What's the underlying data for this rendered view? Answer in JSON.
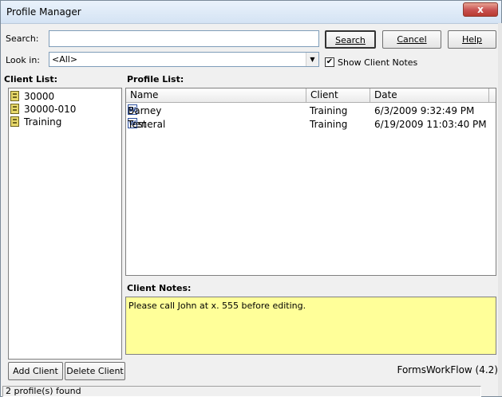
{
  "window": {
    "title": "Profile Manager",
    "close_label": "x"
  },
  "search": {
    "label": "Search:",
    "value": ""
  },
  "look_in": {
    "label": "Look in:",
    "value": "<All>"
  },
  "buttons": {
    "search": "Search",
    "cancel": "Cancel",
    "help": "Help",
    "add_client": "Add Client",
    "delete_client": "Delete Client"
  },
  "show_client_notes": {
    "label": "Show Client Notes",
    "checked": true
  },
  "client_list": {
    "heading": "Client List:",
    "items": [
      "30000",
      "30000-010",
      "Training"
    ]
  },
  "profile_list": {
    "heading": "Profile List:",
    "columns": [
      "Name",
      "Client",
      "Date"
    ],
    "rows": [
      {
        "name": "Barney General",
        "client": "Training",
        "date": "6/3/2009 9:32:49 PM"
      },
      {
        "name": "Test",
        "client": "Training",
        "date": "6/19/2009 11:03:40 PM"
      }
    ]
  },
  "client_notes": {
    "heading": "Client Notes:",
    "text": "Please call John at x. 555 before editing."
  },
  "app_version": "FormsWorkFlow (4.2)",
  "status": "2 profile(s) found",
  "colors": {
    "notes_bg": "#ffff99",
    "close_red": "#c75050"
  }
}
